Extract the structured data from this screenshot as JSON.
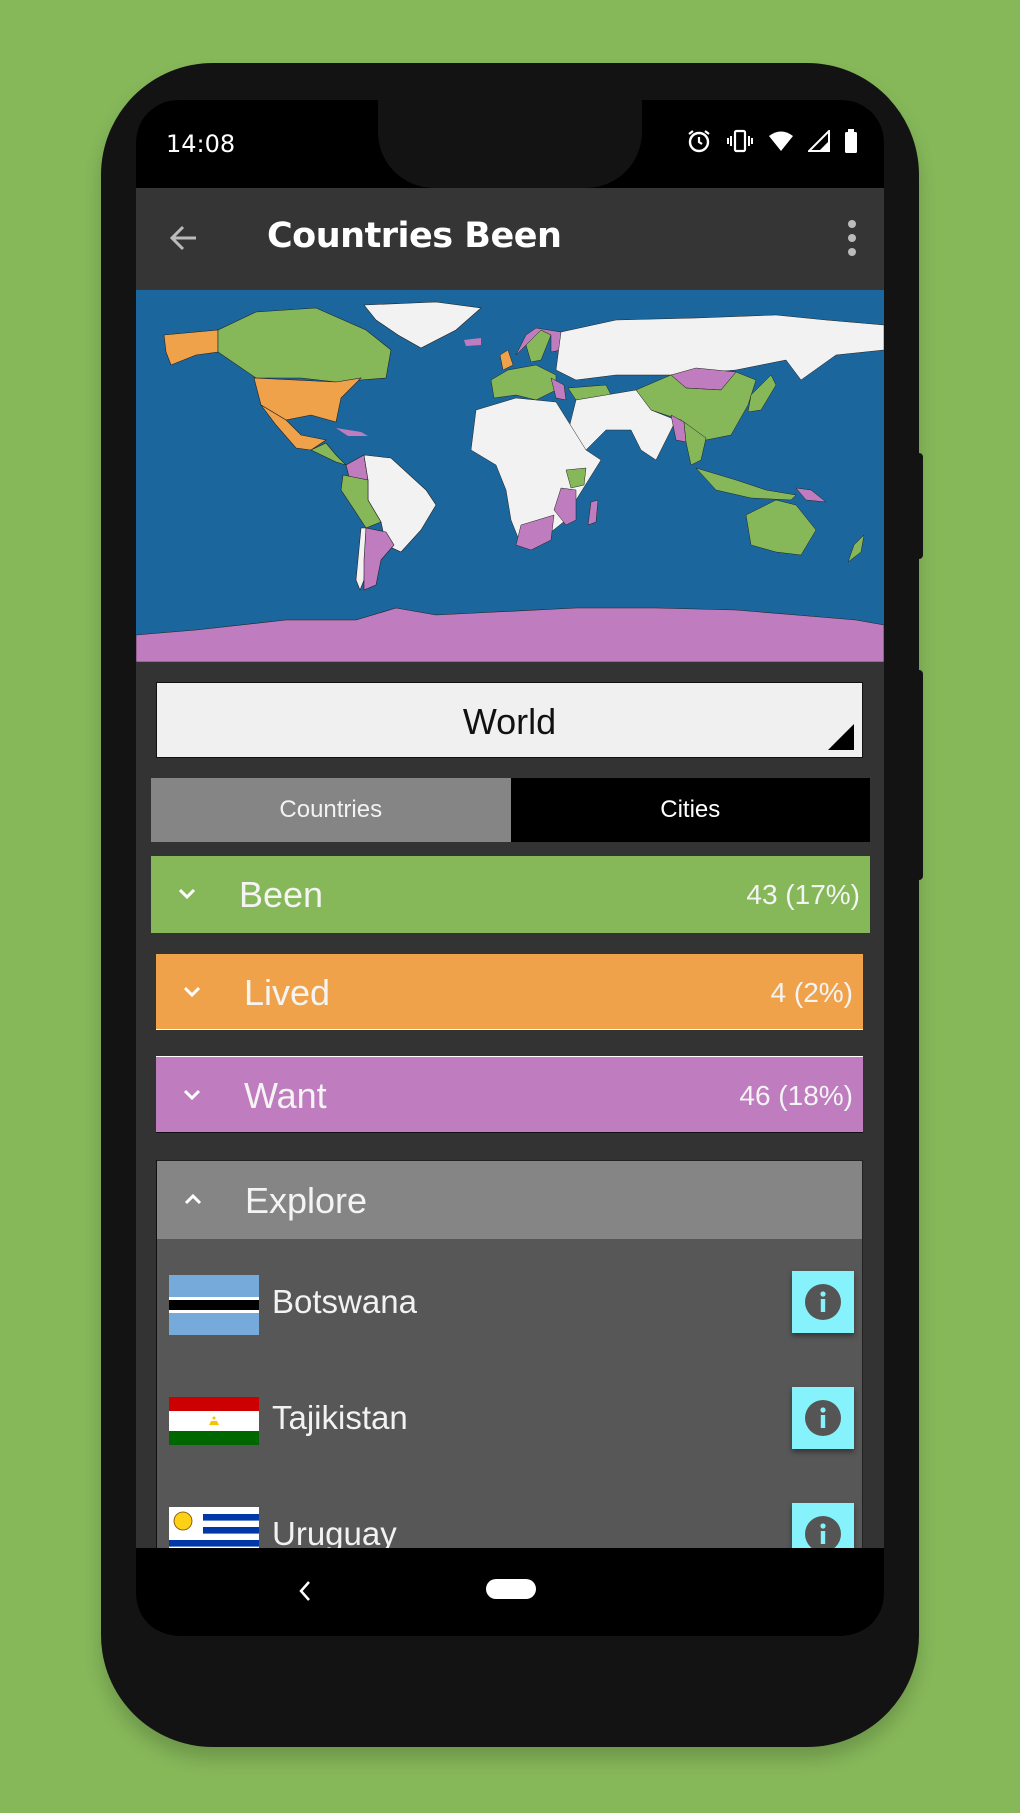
{
  "status_bar": {
    "time": "14:08",
    "icons": [
      "alarm-icon",
      "vibrate-icon",
      "wifi-icon",
      "signal-icon",
      "battery-icon"
    ]
  },
  "app_bar": {
    "title": "Countries Been",
    "back_icon": "arrow-left-icon",
    "menu_icon": "more-vert-icon"
  },
  "map": {
    "description": "World map with countries colored by status",
    "legend_colors": {
      "ocean": "#1B679D",
      "unvisited": "#F2F2F2",
      "been": "#86B85A",
      "lived": "#F0A24B",
      "want": "#BF7CBE"
    }
  },
  "region_selector": {
    "value": "World"
  },
  "tabs": [
    {
      "label": "Countries",
      "active": true
    },
    {
      "label": "Cities",
      "active": false
    }
  ],
  "categories": [
    {
      "label": "Been",
      "count": "43 (17%)",
      "color": "#86B85A",
      "expanded": false
    },
    {
      "label": "Lived",
      "count": "4 (2%)",
      "color": "#F0A24B",
      "expanded": false
    },
    {
      "label": "Want",
      "count": "46 (18%)",
      "color": "#BF7CBE",
      "expanded": false
    }
  ],
  "explore": {
    "label": "Explore",
    "expanded": true,
    "items": [
      {
        "name": "Botswana",
        "flag": "botswana-flag"
      },
      {
        "name": "Tajikistan",
        "flag": "tajikistan-flag"
      },
      {
        "name": "Uruguay",
        "flag": "uruguay-flag"
      }
    ]
  },
  "nav_bar": {
    "back_icon": "nav-back-icon",
    "home_icon": "nav-home-pill"
  }
}
